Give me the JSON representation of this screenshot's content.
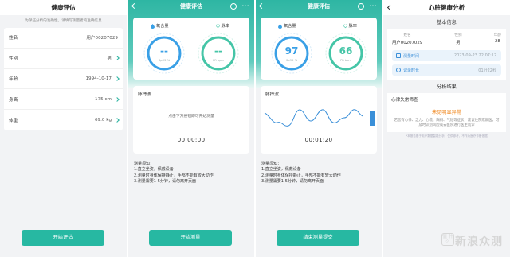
{
  "screen1": {
    "title": "健康评估",
    "hint": "为保证分析的准确性，请填写测量者的准确信息",
    "fields": [
      {
        "label": "姓名",
        "value": "用户00207029"
      },
      {
        "label": "性别",
        "value": "男"
      },
      {
        "label": "年龄",
        "value": "1994-10-17"
      },
      {
        "label": "身高",
        "value": "175 cm"
      },
      {
        "label": "体重",
        "value": "69.0 kg"
      }
    ],
    "button": "开始评估"
  },
  "screen2": {
    "title": "健康评估",
    "menu": "···",
    "spo2_label": "氧含量",
    "pulse_label": "脉率",
    "spo2_value": "--",
    "pulse_value": "--",
    "spo2_unit": "SpO2 %",
    "pulse_unit": "PR bpm",
    "wave_title": "脉搏波",
    "wave_hint": "点击下方按钮即可开始测量",
    "timer": "00:00:00",
    "notes": [
      "测量须知：",
      "1.直立坐姿，佩戴设备",
      "2.测量时身体保持静止，手部不能有较大动作",
      "3.测量需要1-5分钟，请勿离开页面"
    ],
    "button": "开始测量"
  },
  "screen3": {
    "title": "健康评估",
    "menu": "···",
    "spo2_label": "氧含量",
    "pulse_label": "脉率",
    "spo2_value": "97",
    "pulse_value": "66",
    "spo2_unit": "SpO2 %",
    "pulse_unit": "PR bpm",
    "wave_title": "脉搏波",
    "timer": "00:01:20",
    "notes": [
      "测量须知：",
      "1.直立坐姿，佩戴设备",
      "2.测量时身体保持静止，手部不能有较大动作",
      "3.测量需要1-5分钟，请勿离开页面"
    ],
    "button": "结束测量提交"
  },
  "screen4": {
    "title": "心脏健康分析",
    "basic_title": "基本信息",
    "name_header": "姓名",
    "name_value": "用户00207029",
    "gender_header": "性别",
    "gender_value": "男",
    "age_header": "年龄",
    "age_value": "28",
    "measure_time_label": "测量时间",
    "measure_time_value": "2023-09-23 22:07:12",
    "duration_label": "记录时长",
    "duration_value": "01分22秒",
    "result_title": "分析结果",
    "rhythm_title": "心律失常筛查",
    "rhythm_result": "未见明显异常",
    "rhythm_desc": "若您有心悸、乏力、心慌、胸闷、气短等症状，建议住院或就医，可及时识别风险或去医院进行医生就诊",
    "disclaimer": "*本报告基于用户数据智能分析，仅供参考，不作为医疗诊断依据",
    "watermark": "新浪众测",
    "watermark_badge": "值 什么"
  },
  "colors": {
    "teal": "#27b8a2",
    "blue_ring": "#3aa0e6",
    "green_ring": "#45c5a7",
    "orange": "#f08a24"
  }
}
